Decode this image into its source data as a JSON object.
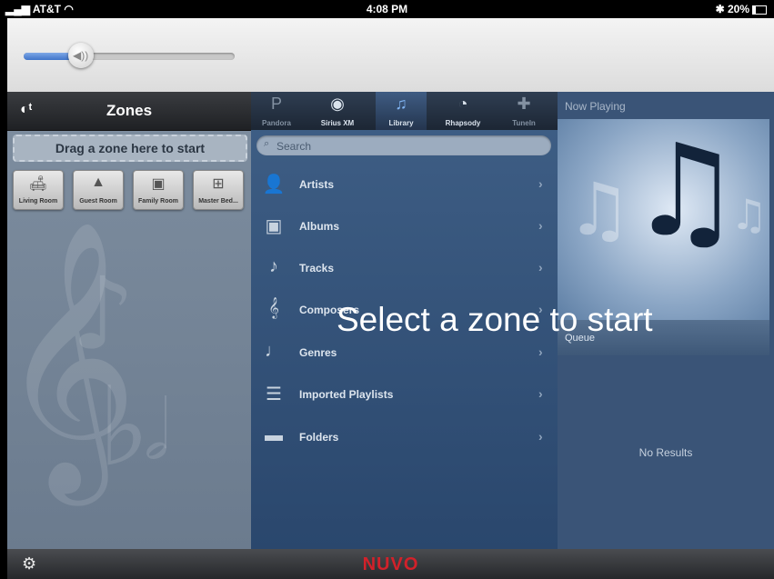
{
  "status_bar": {
    "carrier": "AT&T",
    "time": "4:08 PM",
    "battery": "20%",
    "icons": [
      "signal-icon",
      "wifi-icon",
      "bluetooth-icon",
      "battery-icon"
    ]
  },
  "volume": {
    "level": 0.27,
    "icon": "speaker-icon"
  },
  "zones_panel": {
    "title": "Zones",
    "header_icon": "zones-icon",
    "dropzone_text": "Drag a zone here to start",
    "zones": [
      {
        "label": "Living Room",
        "icon": "sofa-icon"
      },
      {
        "label": "Guest Room",
        "icon": "bed-icon"
      },
      {
        "label": "Family Room",
        "icon": "fireplace-icon"
      },
      {
        "label": "Master Bed...",
        "icon": "master-bed-icon"
      }
    ]
  },
  "sources": {
    "tabs": [
      {
        "label": "Pandora",
        "icon": "pandora-icon",
        "state": "dim"
      },
      {
        "label": "Sirius XM",
        "icon": "siriusxm-icon",
        "state": "normal"
      },
      {
        "label": "Library",
        "icon": "music-note-icon",
        "state": "active"
      },
      {
        "label": "Rhapsody",
        "icon": "rhapsody-icon",
        "state": "normal"
      },
      {
        "label": "TuneIn",
        "icon": "tunein-icon",
        "state": "dim"
      }
    ],
    "search_placeholder": "Search",
    "items": [
      {
        "label": "Artists",
        "icon": "artist-icon"
      },
      {
        "label": "Albums",
        "icon": "album-icon"
      },
      {
        "label": "Tracks",
        "icon": "note-icon"
      },
      {
        "label": "Composers",
        "icon": "clef-icon"
      },
      {
        "label": "Genres",
        "icon": "genres-icon"
      },
      {
        "label": "Imported Playlists",
        "icon": "playlist-icon"
      },
      {
        "label": "Folders",
        "icon": "folder-icon"
      }
    ]
  },
  "now_playing": {
    "title": "Now Playing",
    "queue_label": "Queue",
    "queue_empty": "No Results"
  },
  "overlay_message": "Select a zone to start",
  "footer": {
    "logo": "NUVO",
    "settings_icon": "gear-icon"
  }
}
